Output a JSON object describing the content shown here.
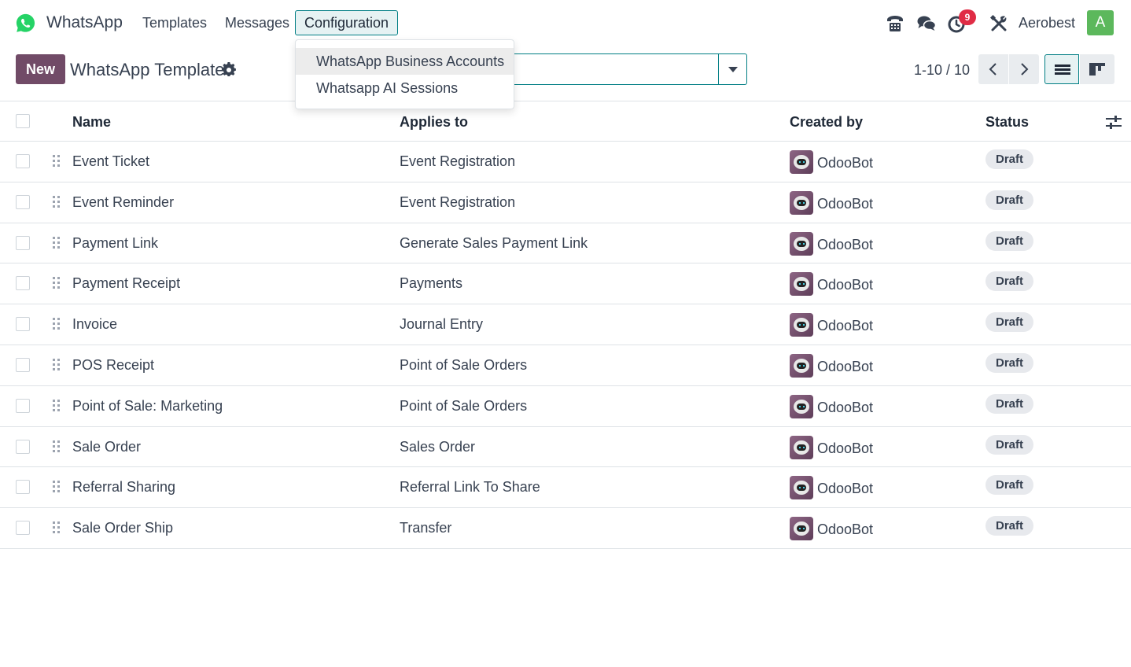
{
  "app": {
    "name": "WhatsApp"
  },
  "nav": {
    "templates": "Templates",
    "messages": "Messages",
    "configuration": "Configuration"
  },
  "systray": {
    "activity_count": "9",
    "company": "Aerobest",
    "avatar_letter": "A"
  },
  "control_panel": {
    "new_label": "New",
    "title": "WhatsApp Template",
    "pager": "1-10 / 10"
  },
  "dropdown": {
    "items": [
      "WhatsApp Business Accounts",
      "Whatsapp AI Sessions"
    ]
  },
  "table": {
    "columns": [
      "Name",
      "Applies to",
      "Created by",
      "Status"
    ],
    "rows": [
      {
        "name": "Event Ticket",
        "applies_to": "Event Registration",
        "created_by": "OdooBot",
        "status": "Draft"
      },
      {
        "name": "Event Reminder",
        "applies_to": "Event Registration",
        "created_by": "OdooBot",
        "status": "Draft"
      },
      {
        "name": "Payment Link",
        "applies_to": "Generate Sales Payment Link",
        "created_by": "OdooBot",
        "status": "Draft"
      },
      {
        "name": "Payment Receipt",
        "applies_to": "Payments",
        "created_by": "OdooBot",
        "status": "Draft"
      },
      {
        "name": "Invoice",
        "applies_to": "Journal Entry",
        "created_by": "OdooBot",
        "status": "Draft"
      },
      {
        "name": "POS Receipt",
        "applies_to": "Point of Sale Orders",
        "created_by": "OdooBot",
        "status": "Draft"
      },
      {
        "name": "Point of Sale: Marketing",
        "applies_to": "Point of Sale Orders",
        "created_by": "OdooBot",
        "status": "Draft"
      },
      {
        "name": "Sale Order",
        "applies_to": "Sales Order",
        "created_by": "OdooBot",
        "status": "Draft"
      },
      {
        "name": "Referral Sharing",
        "applies_to": "Referral Link To Share",
        "created_by": "OdooBot",
        "status": "Draft"
      },
      {
        "name": "Sale Order Ship",
        "applies_to": "Transfer",
        "created_by": "OdooBot",
        "status": "Draft"
      }
    ]
  },
  "colors": {
    "brand": "#714b67",
    "accent": "#017e84",
    "whatsapp": "#25d366",
    "badge": "#e02c45"
  }
}
